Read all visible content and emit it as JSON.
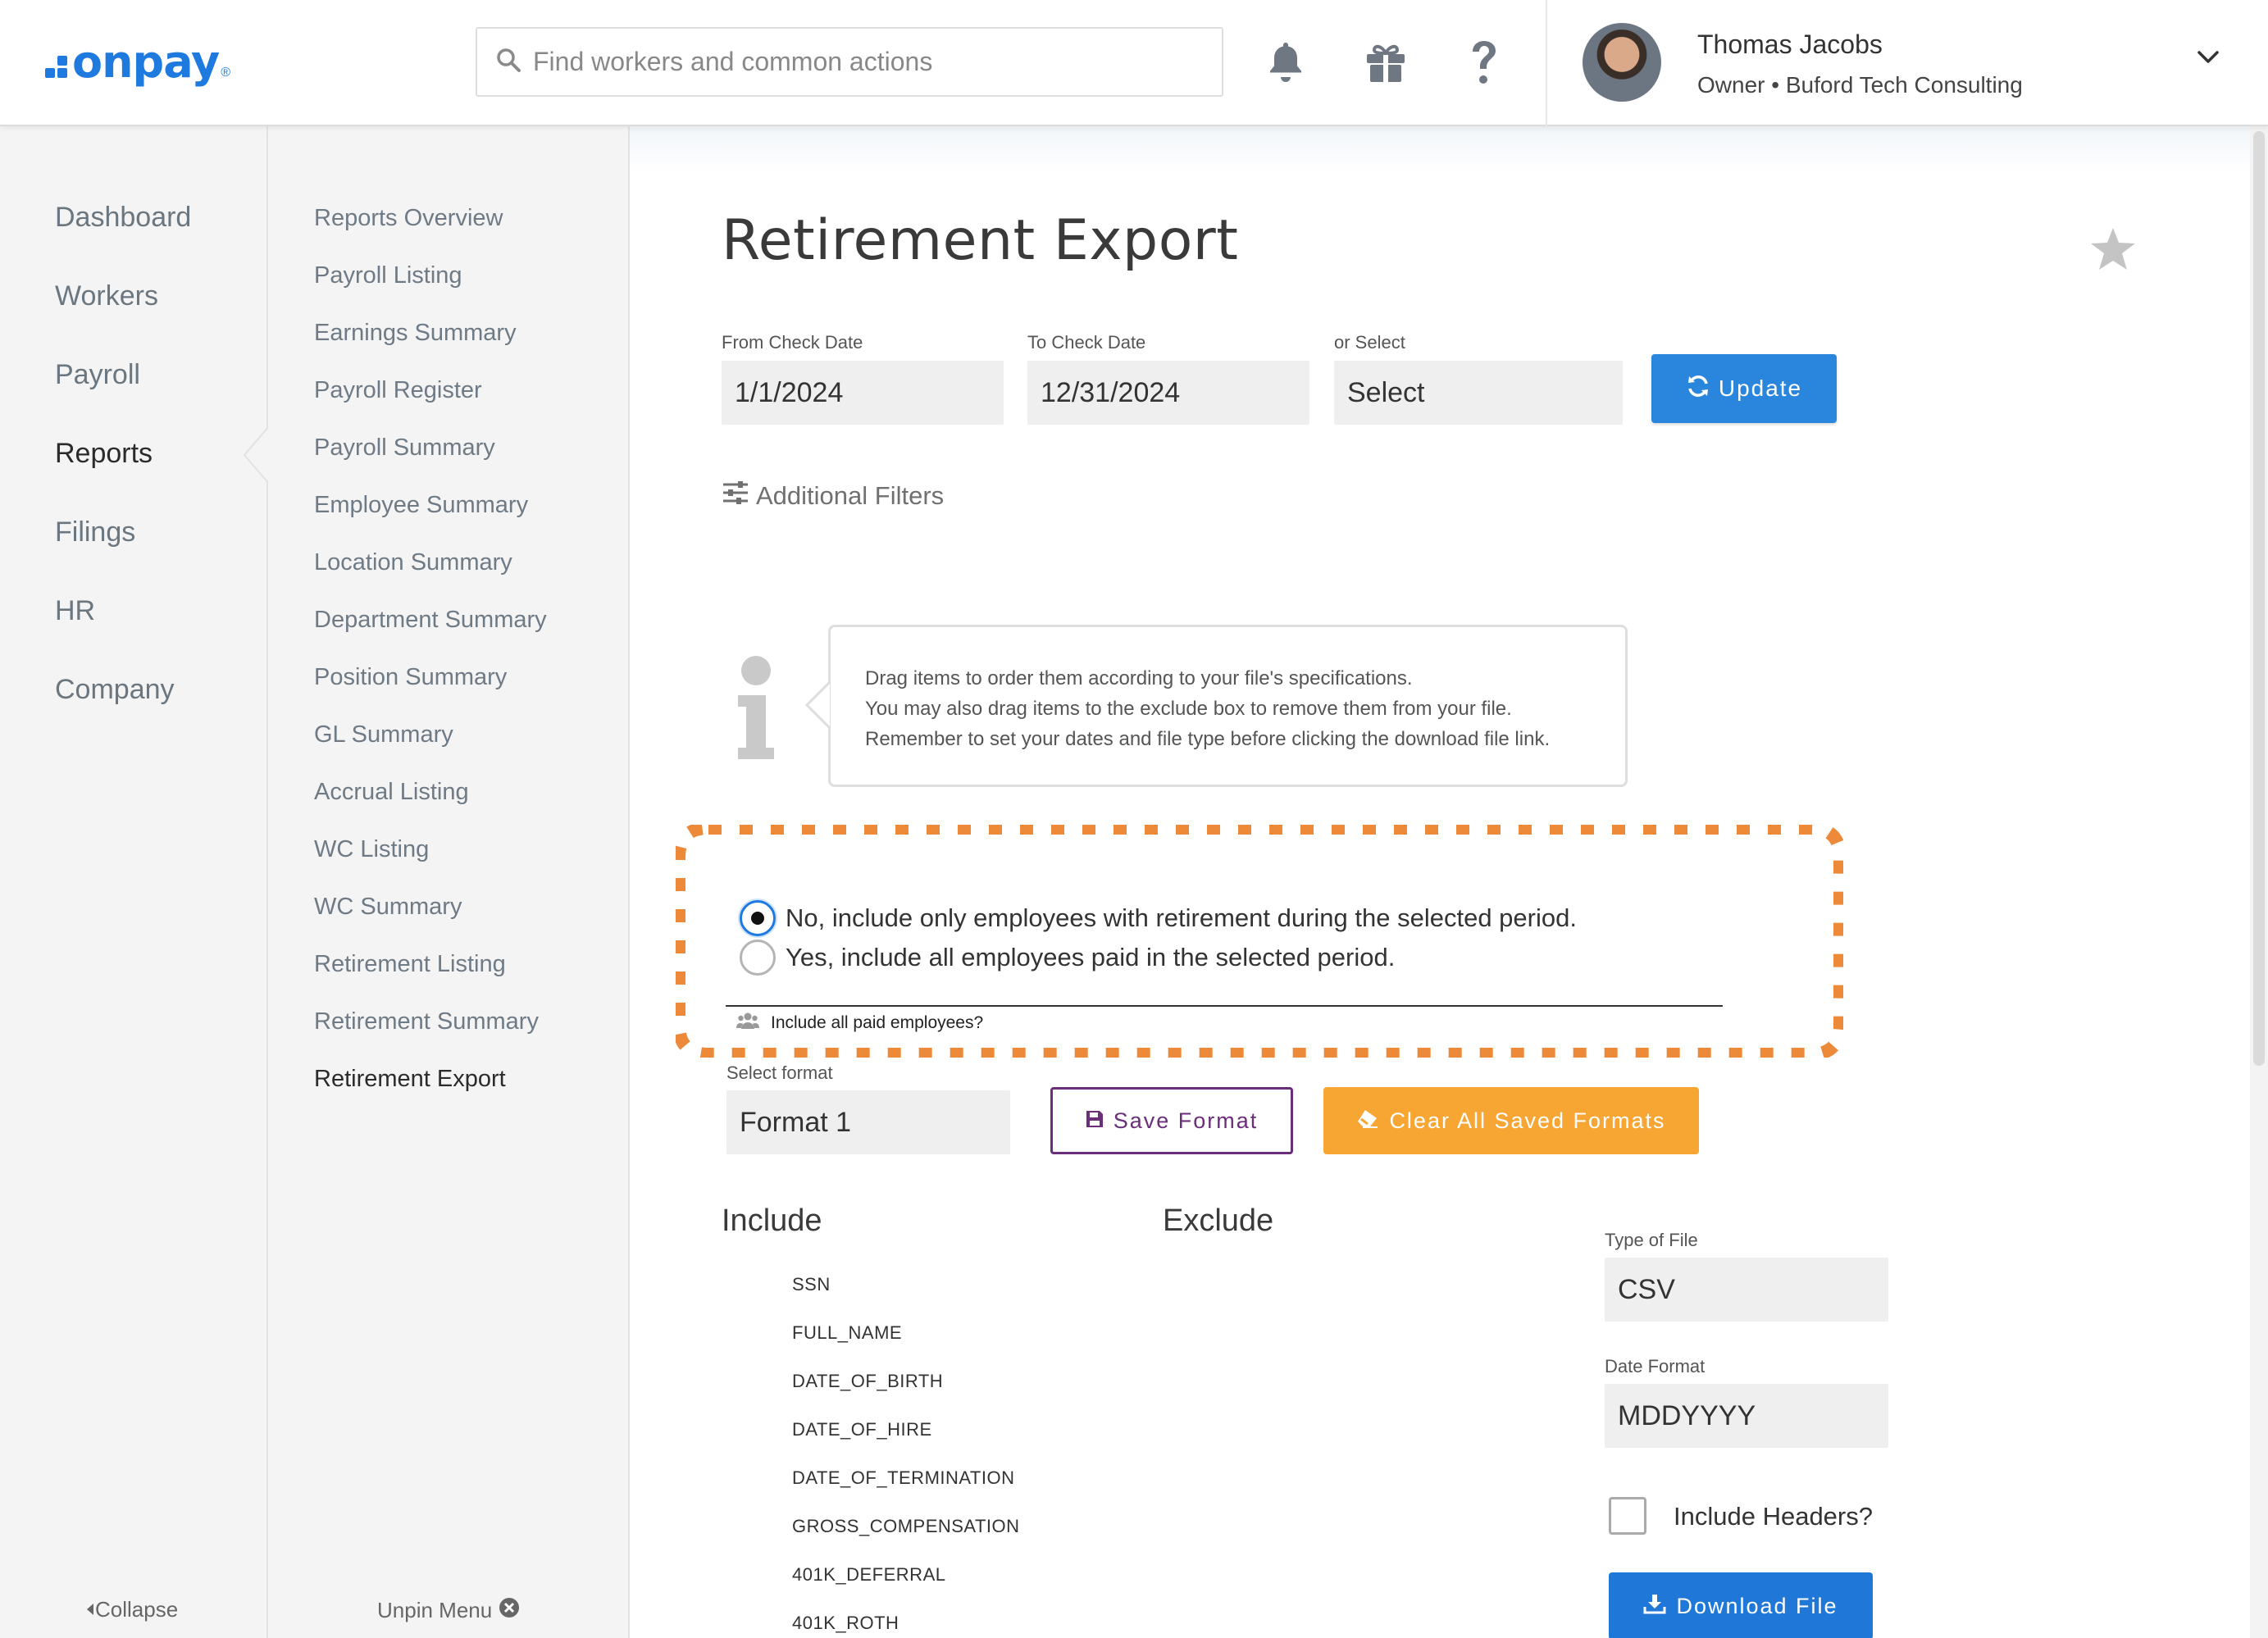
{
  "header": {
    "logo_text": "onpay",
    "logo_reg": "®",
    "search_placeholder": "Find workers and common actions",
    "user_name": "Thomas Jacobs",
    "user_role": "Owner • Buford Tech Consulting"
  },
  "nav_primary": {
    "items": [
      "Dashboard",
      "Workers",
      "Payroll",
      "Reports",
      "Filings",
      "HR",
      "Company"
    ],
    "active": "Reports",
    "collapse_label": "Collapse"
  },
  "nav_secondary": {
    "items": [
      "Reports Overview",
      "Payroll Listing",
      "Earnings Summary",
      "Payroll Register",
      "Payroll Summary",
      "Employee Summary",
      "Location Summary",
      "Department Summary",
      "Position Summary",
      "GL Summary",
      "Accrual Listing",
      "WC Listing",
      "WC Summary",
      "Retirement Listing",
      "Retirement Summary",
      "Retirement Export"
    ],
    "active": "Retirement Export",
    "unpin_label": "Unpin Menu"
  },
  "page": {
    "title": "Retirement Export",
    "from_label": "From Check Date",
    "from_value": "1/1/2024",
    "to_label": "To Check Date",
    "to_value": "12/31/2024",
    "select_label": "or Select",
    "select_value": "Select",
    "update_label": "Update",
    "filters_label": "Additional Filters",
    "info_lines": [
      "Drag items to order them according to your file's specifications.",
      "You may also drag items to the exclude box to remove them from your file.",
      "Remember to set your dates and file type before clicking the download file link."
    ],
    "radio_no": "No, include only employees with retirement during the selected period.",
    "radio_yes": "Yes, include all employees paid in the selected period.",
    "radio_selected": "no",
    "include_paid_label": "Include all paid employees?",
    "format_label": "Select format",
    "format_value": "Format 1",
    "save_format_label": "Save Format",
    "clear_formats_label": "Clear All Saved Formats",
    "include_heading": "Include",
    "exclude_heading": "Exclude",
    "include_items": [
      "SSN",
      "FULL_NAME",
      "DATE_OF_BIRTH",
      "DATE_OF_HIRE",
      "DATE_OF_TERMINATION",
      "GROSS_COMPENSATION",
      "401K_DEFERRAL",
      "401K_ROTH"
    ],
    "file_type_label": "Type of File",
    "file_type_value": "CSV",
    "date_format_label": "Date Format",
    "date_format_value": "MDDYYYY",
    "include_headers_label": "Include Headers?",
    "include_headers_checked": false,
    "download_label": "Download File"
  },
  "colors": {
    "brand": "#1f7ae0",
    "update": "#2a86dc",
    "save_border": "#6b2e7a",
    "clear": "#f7a634",
    "highlight": "#ec8a3a"
  },
  "icons": [
    "search-icon",
    "bell-icon",
    "gift-icon",
    "help-icon",
    "chevron-down-icon",
    "refresh-icon",
    "sliders-icon",
    "info-icon",
    "users-icon",
    "save-icon",
    "eraser-icon",
    "download-icon",
    "star-icon",
    "caret-left-icon",
    "close-circle-icon"
  ]
}
